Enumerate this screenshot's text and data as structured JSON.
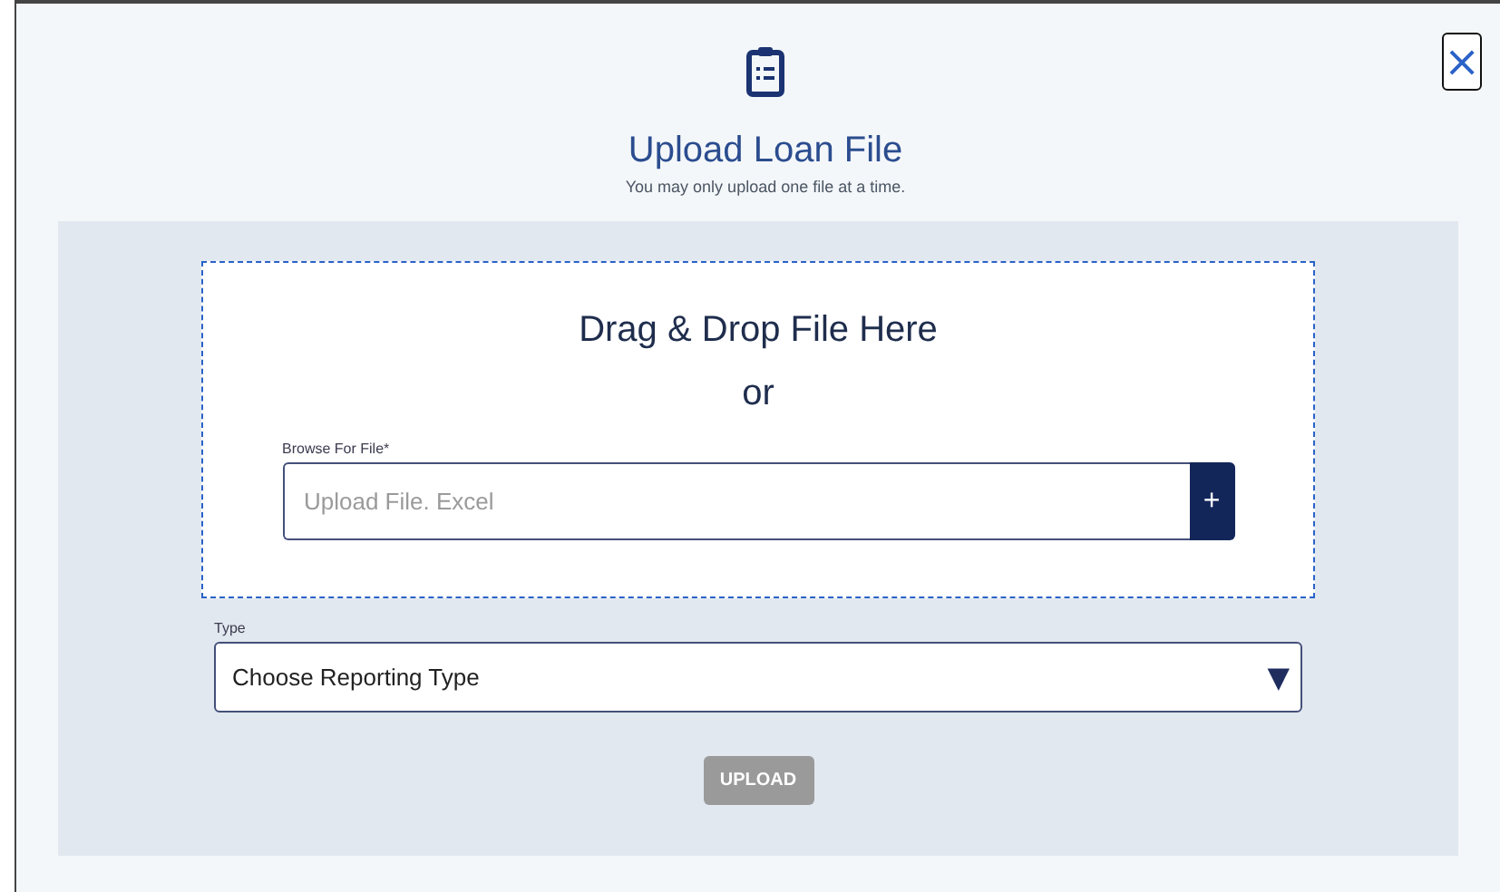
{
  "dialog": {
    "title": "Upload Loan File",
    "subtitle": "You may only upload one file at a time.",
    "close": "×"
  },
  "drop_zone": {
    "heading": "Drag & Drop File Here",
    "or": "or",
    "file_field": {
      "label": "Browse For File*",
      "placeholder": "Upload File. Excel",
      "add_button": "+"
    }
  },
  "type_field": {
    "label": "Type",
    "value": "Choose Reporting Type",
    "caret": "▼"
  },
  "upload_button": {
    "label": "UPLOAD",
    "disabled": true
  }
}
